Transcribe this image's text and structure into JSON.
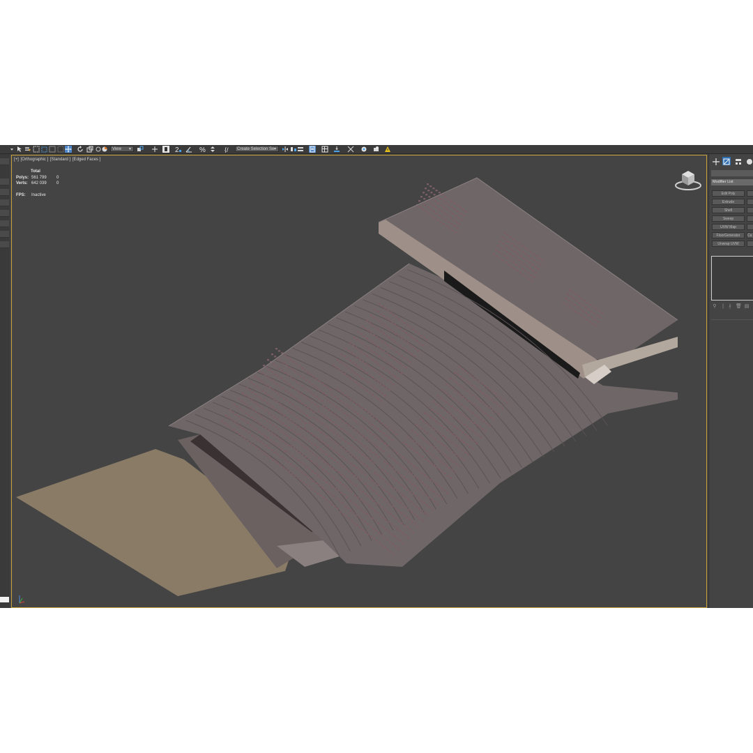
{
  "toolbar": {
    "view_dropdown": "View",
    "selection_set_dropdown": "Create Selection Se"
  },
  "viewport": {
    "labels": [
      "[+]",
      "[Orthographic ]",
      "[Standard ]",
      "[Edged Faces ]"
    ],
    "stats": {
      "header": "Total",
      "polys_label": "Polys:",
      "polys_value": "561 799",
      "polys_selected": "0",
      "verts_label": "Verts:",
      "verts_value": "642 039",
      "verts_selected": "0",
      "fps_label": "FPS:",
      "fps_value": "Inactive"
    }
  },
  "command_panel": {
    "modifier_list": "Modifier List",
    "buttons": [
      {
        "label": "Edit Poly",
        "side": ""
      },
      {
        "label": "Extrude",
        "side": ""
      },
      {
        "label": "Shell",
        "side": ""
      },
      {
        "label": "Sweep",
        "side": ""
      },
      {
        "label": "UVW Map",
        "side": ""
      },
      {
        "label": "FloorGenerator",
        "side": "Ca"
      },
      {
        "label": "Unwrap UVW",
        "side": ""
      }
    ]
  },
  "colors": {
    "viewport_bg": "#444444",
    "viewport_border": "#c8a23a",
    "toolbar_bg": "#3b3b3b",
    "seat": "#7a5e67",
    "floor": "#8a7b66"
  }
}
